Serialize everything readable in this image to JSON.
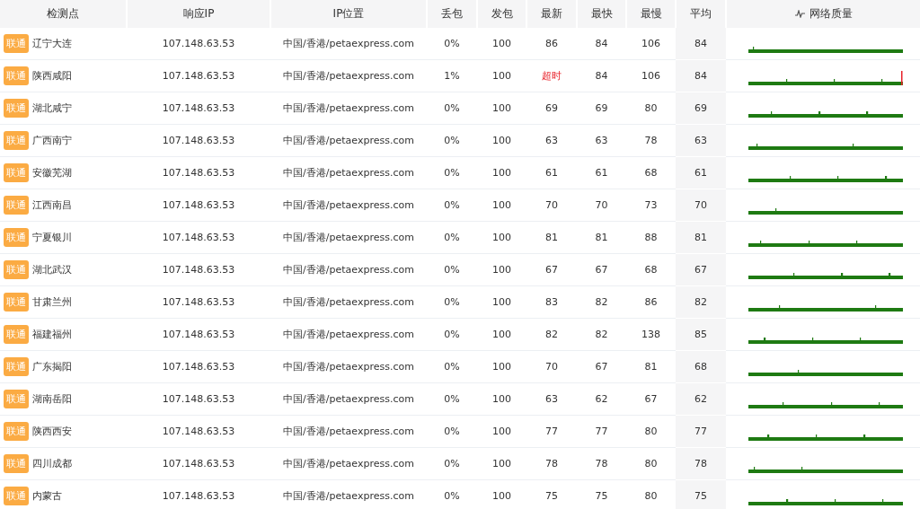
{
  "table": {
    "columns": [
      "检测点",
      "响应IP",
      "IP位置",
      "丢包",
      "发包",
      "最新",
      "最快",
      "最慢",
      "平均",
      "网络质量"
    ],
    "rows": [
      {
        "isp": "联通",
        "location": "辽宁大连",
        "ip": "107.148.63.53",
        "ip_location": "中国/香港/petaexpress.com",
        "loss": "0%",
        "sent": "100",
        "latest": "86",
        "fastest": "84",
        "slowest": "106",
        "average": "84",
        "timeout": false
      },
      {
        "isp": "联通",
        "location": "陕西咸阳",
        "ip": "107.148.63.53",
        "ip_location": "中国/香港/petaexpress.com",
        "loss": "1%",
        "sent": "100",
        "latest": "超时",
        "fastest": "84",
        "slowest": "106",
        "average": "84",
        "timeout": true
      },
      {
        "isp": "联通",
        "location": "湖北咸宁",
        "ip": "107.148.63.53",
        "ip_location": "中国/香港/petaexpress.com",
        "loss": "0%",
        "sent": "100",
        "latest": "69",
        "fastest": "69",
        "slowest": "80",
        "average": "69",
        "timeout": false
      },
      {
        "isp": "联通",
        "location": "广西南宁",
        "ip": "107.148.63.53",
        "ip_location": "中国/香港/petaexpress.com",
        "loss": "0%",
        "sent": "100",
        "latest": "63",
        "fastest": "63",
        "slowest": "78",
        "average": "63",
        "timeout": false
      },
      {
        "isp": "联通",
        "location": "安徽芜湖",
        "ip": "107.148.63.53",
        "ip_location": "中国/香港/petaexpress.com",
        "loss": "0%",
        "sent": "100",
        "latest": "61",
        "fastest": "61",
        "slowest": "68",
        "average": "61",
        "timeout": false
      },
      {
        "isp": "联通",
        "location": "江西南昌",
        "ip": "107.148.63.53",
        "ip_location": "中国/香港/petaexpress.com",
        "loss": "0%",
        "sent": "100",
        "latest": "70",
        "fastest": "70",
        "slowest": "73",
        "average": "70",
        "timeout": false
      },
      {
        "isp": "联通",
        "location": "宁夏银川",
        "ip": "107.148.63.53",
        "ip_location": "中国/香港/petaexpress.com",
        "loss": "0%",
        "sent": "100",
        "latest": "81",
        "fastest": "81",
        "slowest": "88",
        "average": "81",
        "timeout": false
      },
      {
        "isp": "联通",
        "location": "湖北武汉",
        "ip": "107.148.63.53",
        "ip_location": "中国/香港/petaexpress.com",
        "loss": "0%",
        "sent": "100",
        "latest": "67",
        "fastest": "67",
        "slowest": "68",
        "average": "67",
        "timeout": false
      },
      {
        "isp": "联通",
        "location": "甘肃兰州",
        "ip": "107.148.63.53",
        "ip_location": "中国/香港/petaexpress.com",
        "loss": "0%",
        "sent": "100",
        "latest": "83",
        "fastest": "82",
        "slowest": "86",
        "average": "82",
        "timeout": false
      },
      {
        "isp": "联通",
        "location": "福建福州",
        "ip": "107.148.63.53",
        "ip_location": "中国/香港/petaexpress.com",
        "loss": "0%",
        "sent": "100",
        "latest": "82",
        "fastest": "82",
        "slowest": "138",
        "average": "85",
        "timeout": false
      },
      {
        "isp": "联通",
        "location": "广东揭阳",
        "ip": "107.148.63.53",
        "ip_location": "中国/香港/petaexpress.com",
        "loss": "0%",
        "sent": "100",
        "latest": "70",
        "fastest": "67",
        "slowest": "81",
        "average": "68",
        "timeout": false
      },
      {
        "isp": "联通",
        "location": "湖南岳阳",
        "ip": "107.148.63.53",
        "ip_location": "中国/香港/petaexpress.com",
        "loss": "0%",
        "sent": "100",
        "latest": "63",
        "fastest": "62",
        "slowest": "67",
        "average": "62",
        "timeout": false
      },
      {
        "isp": "联通",
        "location": "陕西西安",
        "ip": "107.148.63.53",
        "ip_location": "中国/香港/petaexpress.com",
        "loss": "0%",
        "sent": "100",
        "latest": "77",
        "fastest": "77",
        "slowest": "80",
        "average": "77",
        "timeout": false
      },
      {
        "isp": "联通",
        "location": "四川成都",
        "ip": "107.148.63.53",
        "ip_location": "中国/香港/petaexpress.com",
        "loss": "0%",
        "sent": "100",
        "latest": "78",
        "fastest": "78",
        "slowest": "80",
        "average": "78",
        "timeout": false
      },
      {
        "isp": "联通",
        "location": "内蒙古",
        "ip": "107.148.63.53",
        "ip_location": "中国/香港/petaexpress.com",
        "loss": "0%",
        "sent": "100",
        "latest": "75",
        "fastest": "75",
        "slowest": "80",
        "average": "75",
        "timeout": false
      }
    ]
  }
}
